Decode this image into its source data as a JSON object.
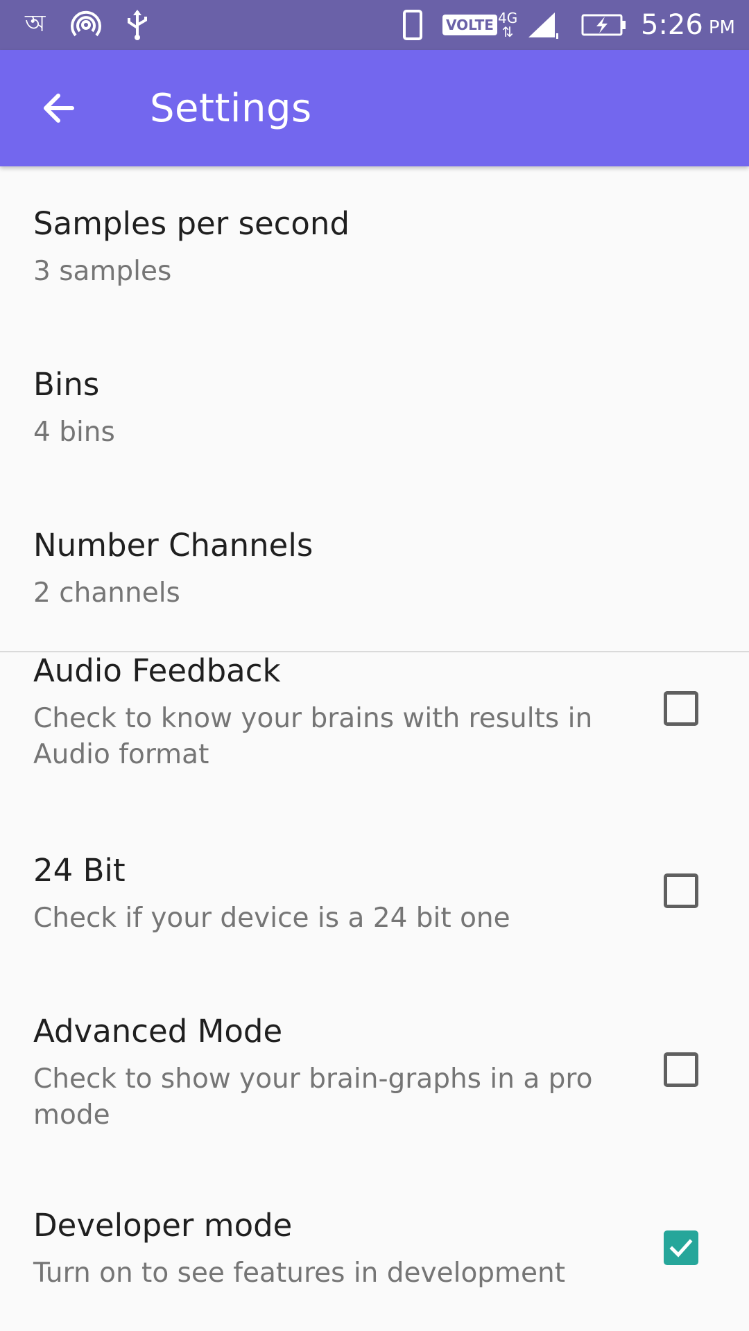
{
  "status_bar": {
    "time": "5:26",
    "ampm": "PM",
    "lang_glyph": "অ",
    "volte": "VOLTE",
    "network": "4G",
    "icons": [
      "hotspot-icon",
      "usb-icon",
      "phone-icon",
      "signal-icon",
      "battery-charging-icon"
    ]
  },
  "toolbar": {
    "title": "Settings",
    "back_icon": "arrow-back-icon"
  },
  "prefs": [
    {
      "title": "Samples per second",
      "summary": "3 samples"
    },
    {
      "title": "Bins",
      "summary": "4 bins"
    },
    {
      "title": "Number Channels",
      "summary": "2 channels"
    },
    {
      "title": "Audio Feedback",
      "summary": "Check to know your brains with results in Audio format",
      "checked": false
    },
    {
      "title": "24 Bit",
      "summary": "Check if your device is a 24 bit one",
      "checked": false
    },
    {
      "title": "Advanced Mode",
      "summary": "Check to show your brain-graphs in a pro mode",
      "checked": false
    },
    {
      "title": "Developer mode",
      "summary": "Turn on to see features in development",
      "checked": true
    }
  ],
  "colors": {
    "status_bar": "#6A61A8",
    "toolbar": "#7367EE",
    "checkbox_checked": "#26A69A",
    "background": "#FAFAFA"
  }
}
